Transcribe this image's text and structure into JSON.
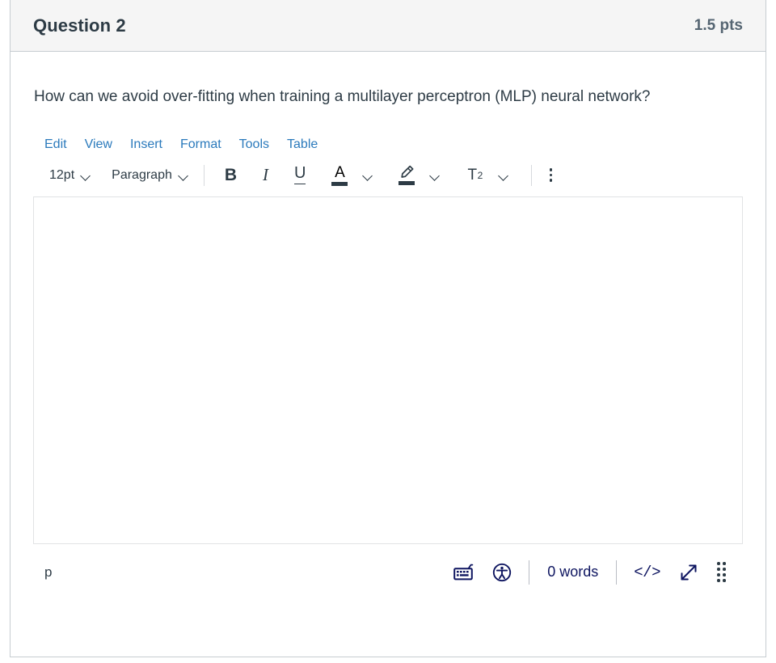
{
  "question": {
    "title": "Question 2",
    "points": "1.5 pts",
    "text": "How can we avoid over-fitting when training a multilayer perceptron (MLP) neural network?"
  },
  "editor": {
    "menubar": [
      {
        "label": "Edit",
        "name": "menu-edit"
      },
      {
        "label": "View",
        "name": "menu-view"
      },
      {
        "label": "Insert",
        "name": "menu-insert"
      },
      {
        "label": "Format",
        "name": "menu-format"
      },
      {
        "label": "Tools",
        "name": "menu-tools"
      },
      {
        "label": "Table",
        "name": "menu-table"
      }
    ],
    "toolbar": {
      "font_size": "12pt",
      "block_format": "Paragraph",
      "bold": "B",
      "italic": "I",
      "underline": "U",
      "text_color": "A",
      "superscript_base": "T",
      "superscript_exponent": "2"
    },
    "content": "",
    "statusbar": {
      "element_path": "p",
      "word_count": "0 words",
      "html_editor": "</>"
    }
  },
  "colors": {
    "link": "#2b7abc",
    "text": "#2d3b45",
    "muted": "#556572",
    "status": "#0e1560",
    "header_bg": "#f5f5f5",
    "border": "#c7cdd1",
    "editor_border": "#e1e3e5"
  }
}
